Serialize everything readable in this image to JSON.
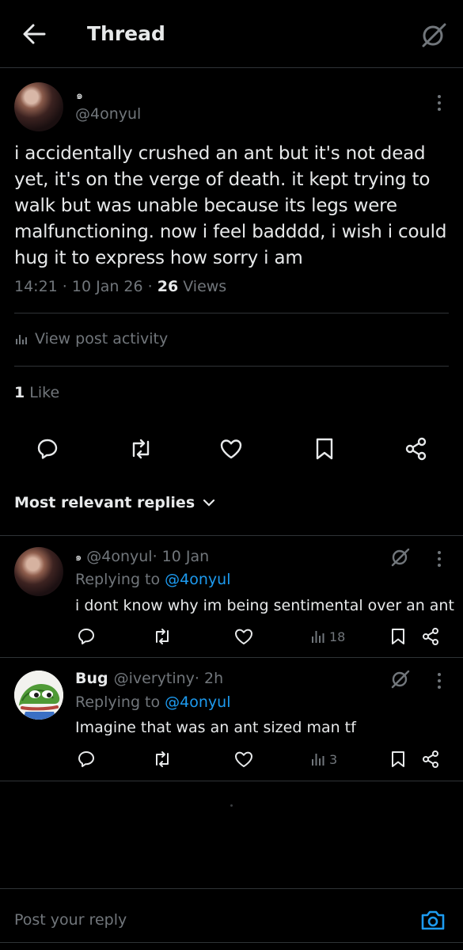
{
  "header": {
    "title": "Thread"
  },
  "post": {
    "author_icon": "spiral-verified-icon",
    "author_spiral": "๑",
    "handle": "@4onyul",
    "text": "i accidentally crushed an ant but it's not dead yet, it's on the verge of death. it kept trying to walk but was unable because its legs were malfunctioning. now i feel badddd, i wish i could hug it to express how sorry i am",
    "time": "14:21 · 10 Jan 26 · ",
    "views_count": "26",
    "views_label": " Views",
    "activity_label": "View post activity",
    "likes_count": "1",
    "likes_label": " Like"
  },
  "replies_header": {
    "label": "Most relevant replies"
  },
  "replies": [
    {
      "spiral": "๑",
      "handle": "@4onyul",
      "time": " · 10 Jan",
      "replying_prefix": "Replying to ",
      "replying_to": "@4onyul",
      "text": "i dont know why im being sentimental over an ant",
      "views": "18"
    },
    {
      "name": "Bug",
      "handle": "@iverytiny",
      "time": " · 2h",
      "replying_prefix": "Replying to ",
      "replying_to": "@4onyul",
      "text": "Imagine that was an ant sized man tf",
      "views": "3"
    }
  ],
  "composer": {
    "placeholder": "Post your reply"
  },
  "colors": {
    "background": "#000000",
    "text": "#e7e9ea",
    "muted": "#71767b",
    "accent": "#1d9bf0",
    "divider": "#2f3336"
  }
}
